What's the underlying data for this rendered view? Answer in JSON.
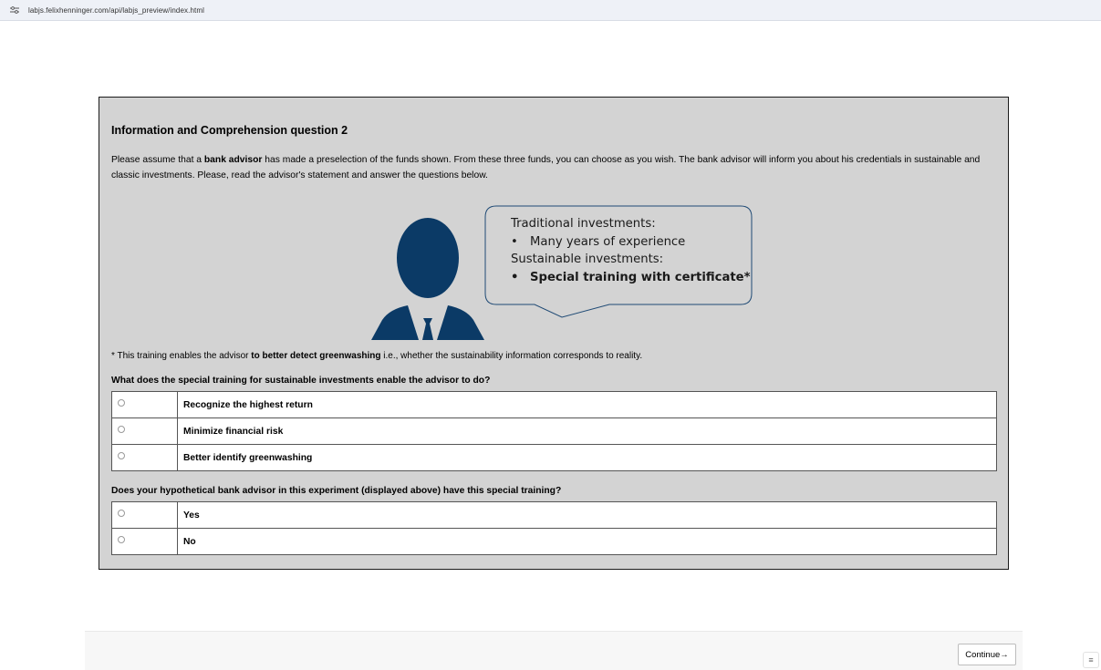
{
  "browser": {
    "url": "labjs.felixhenninger.com/api/labjs_preview/index.html",
    "site_icon": "site-settings-icon"
  },
  "page": {
    "title": "Information and Comprehension question 2",
    "intro": {
      "part1": "Please assume that a ",
      "bold1": "bank advisor",
      "part2": " has made a preselection of the funds shown. From these three funds, you can choose as you wish. The bank advisor will inform you about his credentials in sustainable and classic investments. Please, read the advisor's statement and answer the questions below."
    },
    "figure": {
      "avatar_icon": "businessman-icon",
      "accent_color": "#0b3a66",
      "bubble_lines": [
        "Traditional investments:",
        "Many years of experience",
        "Sustainable investments:",
        "Special training with certificate*"
      ],
      "bullet": "•"
    },
    "footnote": {
      "part1": "* This training enables the advisor ",
      "bold": "to better detect greenwashing",
      "part2": " i.e., whether the sustainability information corresponds to reality."
    },
    "question1": {
      "text": "What does the special training for sustainable investments enable the advisor to do?",
      "options": [
        "Recognize the highest return",
        "Minimize financial risk",
        "Better identify greenwashing"
      ]
    },
    "question2": {
      "text": "Does your hypothetical bank advisor in this experiment (displayed above) have this special training?",
      "options": [
        "Yes",
        "No"
      ]
    }
  },
  "footer": {
    "continue_label": "Continue→",
    "menu_icon": "hamburger-menu-icon",
    "menu_glyph": "≡"
  }
}
